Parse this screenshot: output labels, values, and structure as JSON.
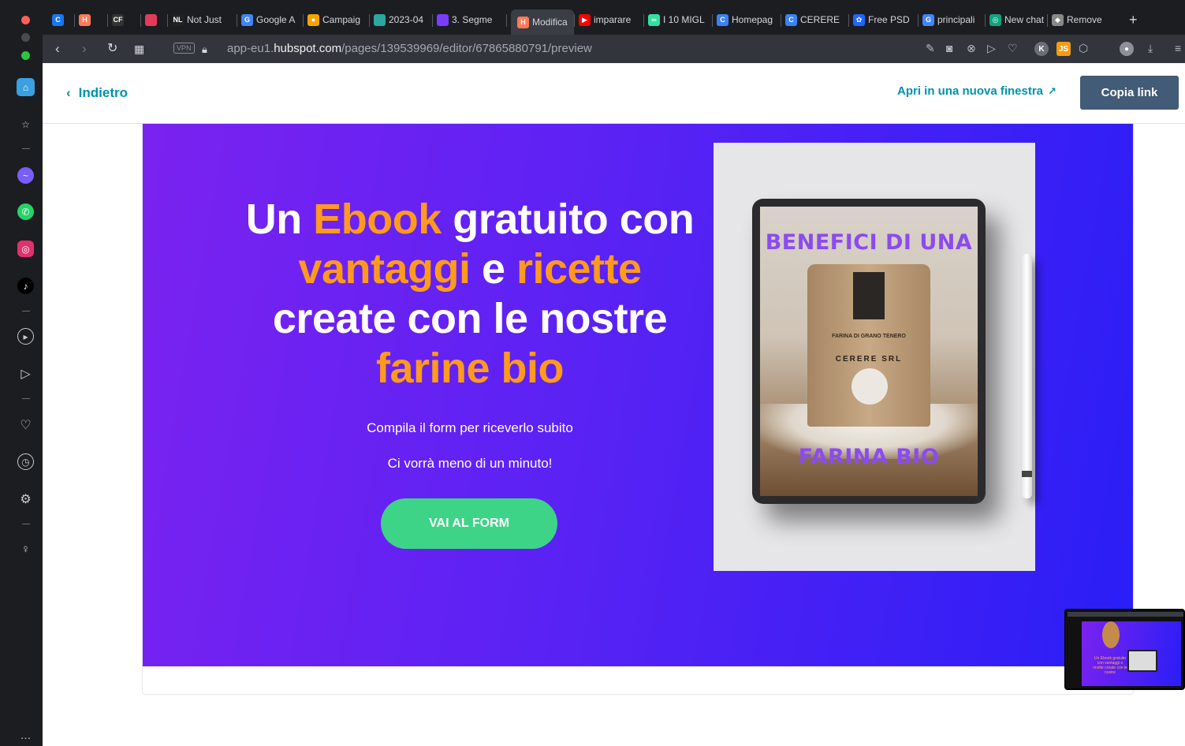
{
  "browser": {
    "tabs": [
      {
        "label": "",
        "fav": "C",
        "color": "#1877f2"
      },
      {
        "label": "",
        "fav": "H",
        "color": "#ff7a59"
      },
      {
        "label": "",
        "fav": "CF",
        "color": "#333333"
      },
      {
        "label": "",
        "fav": "",
        "color": "#e33b5a"
      },
      {
        "label": "Not Just",
        "fav": "NL",
        "color": "#222222"
      },
      {
        "label": "Google A",
        "fav": "G",
        "color": "#4285f4"
      },
      {
        "label": "Campaig",
        "fav": "●",
        "color": "#f4a300"
      },
      {
        "label": "2023-04",
        "fav": "",
        "color": "#2aa8a0"
      },
      {
        "label": "3. Segme",
        "fav": "",
        "color": "#7a3cff"
      },
      {
        "label": "Modifica",
        "fav": "H",
        "color": "#ff7a59"
      },
      {
        "label": "imparare",
        "fav": "▶",
        "color": "#ff0000"
      },
      {
        "label": "I 10 MIGL",
        "fav": "∞",
        "color": "#34e0a1"
      },
      {
        "label": "Homepag",
        "fav": "C",
        "color": "#3b82f6"
      },
      {
        "label": "CERERE",
        "fav": "C",
        "color": "#3b82f6"
      },
      {
        "label": "Free PSD",
        "fav": "✿",
        "color": "#1e66ff"
      },
      {
        "label": "principali",
        "fav": "G",
        "color": "#4285f4"
      },
      {
        "label": "New chat",
        "fav": "◎",
        "color": "#10a37f"
      },
      {
        "label": "Remove",
        "fav": "◆",
        "color": "#888888"
      }
    ],
    "new_tab": "+",
    "vpn_label": "VPN",
    "url_prefix": "app-eu1.",
    "url_host": "hubspot.com",
    "url_path": "/pages/139539969/editor/67865880791/preview",
    "avatar_k": "K",
    "ext_js": "JS"
  },
  "hubspot": {
    "back_label": "Indietro",
    "open_new_label": "Apri in una nuova finestra",
    "copy_link_label": "Copia link"
  },
  "hero": {
    "line1_a": "Un ",
    "line1_b": "Ebook",
    "line1_c": " gratuito con",
    "line2_a": "vantaggi",
    "line2_b": " e ",
    "line2_c": "ricette",
    "line3": "create con le nostre",
    "line4": "farine bio",
    "subtitle1": "Compila il form per riceverlo subito",
    "subtitle2": "Ci vorrà meno di un minuto!",
    "cta_label": "VAI AL FORM",
    "ebook_title_top": "BENEFICI DI UNA",
    "ebook_title_bottom": "FARINA BIO",
    "bag_text1": "FARINA DI GRANO TENERO",
    "bag_text2": "CERERE SRL"
  },
  "thumbnail": {
    "text": "Un Ebook gratuito con vantaggi e ricette create con le nostre"
  },
  "colors": {
    "accent_orange": "#ff9a1f",
    "cta_green": "#3ed488",
    "hubspot_teal": "#0091ae",
    "copy_btn": "#425b76"
  }
}
